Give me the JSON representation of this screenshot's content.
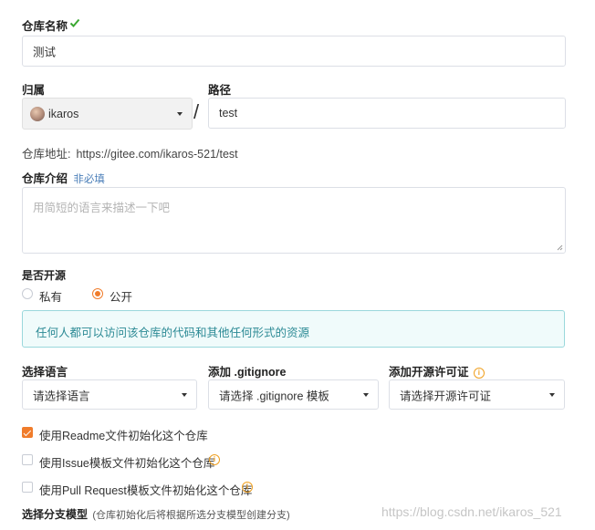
{
  "repo_name": {
    "label": "仓库名称",
    "value": "测试"
  },
  "owner": {
    "label": "归属",
    "value": "ikaros"
  },
  "separator": "/",
  "path": {
    "label": "路径",
    "value": "test"
  },
  "address": {
    "prefix": "仓库地址:",
    "url": "https://gitee.com/ikaros-521/test"
  },
  "intro": {
    "label": "仓库介绍",
    "optional": "非必填",
    "placeholder": "用简短的语言来描述一下吧"
  },
  "open_source": {
    "label": "是否开源",
    "options": [
      "私有",
      "公开"
    ],
    "selected": "公开",
    "notice": "任何人都可以访问该仓库的代码和其他任何形式的资源"
  },
  "language": {
    "label": "选择语言",
    "value": "请选择语言"
  },
  "gitignore": {
    "label": "添加 .gitignore",
    "value": "请选择 .gitignore 模板"
  },
  "license": {
    "label": "添加开源许可证",
    "value": "请选择开源许可证"
  },
  "init_options": [
    {
      "label": "使用Readme文件初始化这个仓库",
      "checked": true
    },
    {
      "label": "使用Issue模板文件初始化这个仓库",
      "checked": false
    },
    {
      "label": "使用Pull Request模板文件初始化这个仓库",
      "checked": false
    }
  ],
  "branch_model": {
    "label": "选择分支模型",
    "hint": "(仓库初始化后将根据所选分支模型创建分支)"
  },
  "watermark": "https://blog.csdn.net/ikaros_521",
  "colors": {
    "accent": "#f07c2b",
    "check_green": "#3aa832",
    "notice_bg": "#f0fbfb",
    "notice_border": "#9ad8dc",
    "hint_blue": "#4a7eb8"
  },
  "icons": {
    "name_ok": "checkmark-icon",
    "info": "info-icon",
    "select": "chevron-down-icon"
  }
}
